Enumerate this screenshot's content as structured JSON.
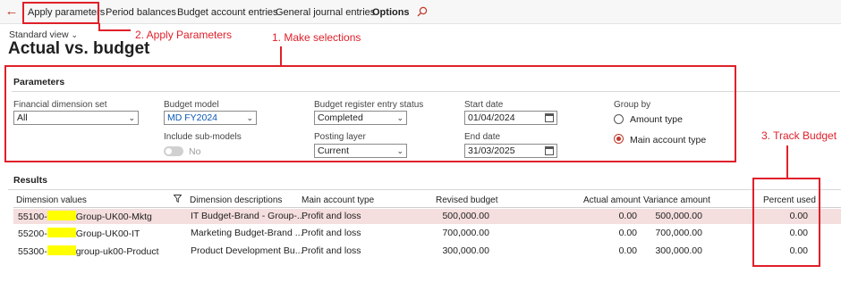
{
  "actionpane": {
    "items": [
      "Apply parameters",
      "Period balances",
      "Budget account entries",
      "General journal entries",
      "Options"
    ]
  },
  "header": {
    "view": "Standard view",
    "title": "Actual vs. budget"
  },
  "annotations": {
    "apply": "2. Apply Parameters",
    "selections": "1. Make selections",
    "track": "3. Track Budget"
  },
  "parameters": {
    "title": "Parameters",
    "financial_dimension_set": {
      "label": "Financial dimension set",
      "value": "All"
    },
    "budget_model": {
      "label": "Budget model",
      "value": "MD FY2024"
    },
    "include_sub_models": {
      "label": "Include sub-models",
      "value": "No"
    },
    "register_status": {
      "label": "Budget register entry status",
      "value": "Completed"
    },
    "posting_layer": {
      "label": "Posting layer",
      "value": "Current"
    },
    "start_date": {
      "label": "Start date",
      "value": "01/04/2024"
    },
    "end_date": {
      "label": "End date",
      "value": "31/03/2025"
    },
    "group_by": {
      "label": "Group by",
      "options": [
        "Amount type",
        "Main account type"
      ],
      "selected": "Main account type"
    }
  },
  "results": {
    "title": "Results",
    "columns": [
      "Dimension values",
      "Dimension descriptions",
      "Main account type",
      "Revised budget",
      "Actual amount",
      "Variance amount",
      "Percent used"
    ],
    "rows": [
      {
        "code": "55100-",
        "suffix": "Group-UK00-Mktg",
        "description": "IT Budget-Brand - Group-...",
        "type": "Profit and loss",
        "revised": "500,000.00",
        "actual": "0.00",
        "variance": "500,000.00",
        "percent": "0.00"
      },
      {
        "code": "55200-",
        "suffix": "Group-UK00-IT",
        "description": "Marketing Budget-Brand ...",
        "type": "Profit and loss",
        "revised": "700,000.00",
        "actual": "0.00",
        "variance": "700,000.00",
        "percent": "0.00"
      },
      {
        "code": "55300-",
        "suffix": "group-uk00-Product",
        "description": "Product Development Bu...",
        "type": "Profit and loss",
        "revised": "300,000.00",
        "actual": "0.00",
        "variance": "300,000.00",
        "percent": "0.00"
      }
    ]
  },
  "colors": {
    "annotation": "#e0202a",
    "selected_row": "#f5dede",
    "redaction": "#ffff00",
    "link_blue": "#0b57b5"
  }
}
